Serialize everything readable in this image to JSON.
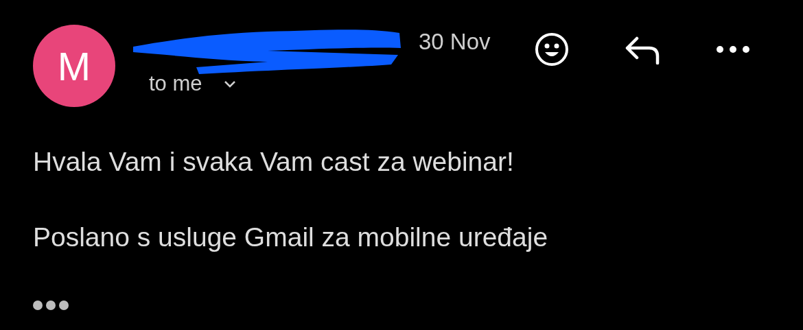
{
  "message": {
    "avatar_letter": "M",
    "sender_redacted": true,
    "date": "30 Nov",
    "recipient": "to me",
    "body": [
      "Hvala Vam i svaka Vam cast za webinar!",
      "Poslano s usluge Gmail za mobilne uređaje"
    ]
  }
}
